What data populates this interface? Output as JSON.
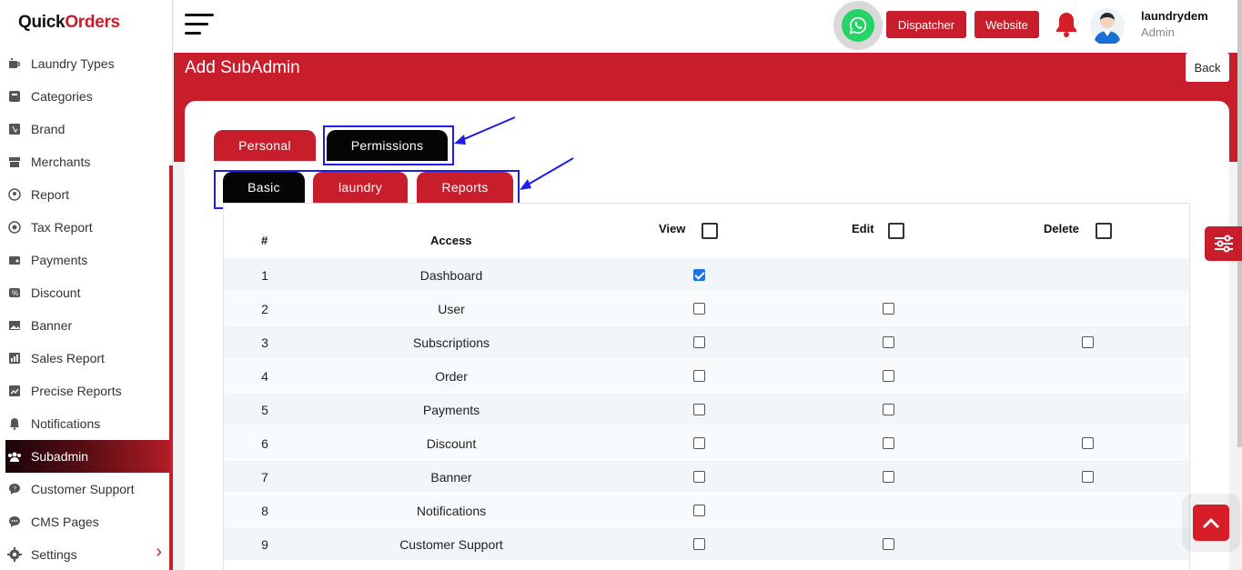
{
  "brand": {
    "part1": "Quick",
    "part2": "Orders"
  },
  "sidebar": {
    "items": [
      {
        "label": "Laundry Types",
        "icon": "cup-icon"
      },
      {
        "label": "Categories",
        "icon": "box-icon"
      },
      {
        "label": "Brand",
        "icon": "bookmark-icon"
      },
      {
        "label": "Merchants",
        "icon": "store-icon"
      },
      {
        "label": "Report",
        "icon": "report-icon"
      },
      {
        "label": "Tax Report",
        "icon": "tax-icon"
      },
      {
        "label": "Payments",
        "icon": "wallet-icon"
      },
      {
        "label": "Discount",
        "icon": "percent-icon"
      },
      {
        "label": "Banner",
        "icon": "image-icon"
      },
      {
        "label": "Sales Report",
        "icon": "chart-icon"
      },
      {
        "label": "Precise Reports",
        "icon": "chart-line-icon"
      },
      {
        "label": "Notifications",
        "icon": "bell-icon"
      },
      {
        "label": "Subadmin",
        "icon": "users-icon",
        "active": true
      },
      {
        "label": "Customer Support",
        "icon": "chat-icon"
      },
      {
        "label": "CMS Pages",
        "icon": "message-icon"
      },
      {
        "label": "Settings",
        "icon": "gear-icon"
      }
    ]
  },
  "header": {
    "dispatcher_label": "Dispatcher",
    "website_label": "Website",
    "user_name": "laundrydem",
    "user_role": "Admin"
  },
  "page": {
    "title": "Add SubAdmin",
    "back_label": "Back"
  },
  "tabs": {
    "personal": "Personal",
    "permissions": "Permissions"
  },
  "subtabs": {
    "basic": "Basic",
    "laundry": "laundry",
    "reports": "Reports"
  },
  "table": {
    "headers": {
      "num": "#",
      "access": "Access",
      "view": "View",
      "edit": "Edit",
      "delete": "Delete"
    },
    "rows": [
      {
        "num": "1",
        "access": "Dashboard",
        "view": true,
        "edit": null,
        "delete": null
      },
      {
        "num": "2",
        "access": "User",
        "view": false,
        "edit": false,
        "delete": null
      },
      {
        "num": "3",
        "access": "Subscriptions",
        "view": false,
        "edit": false,
        "delete": false
      },
      {
        "num": "4",
        "access": "Order",
        "view": false,
        "edit": false,
        "delete": null
      },
      {
        "num": "5",
        "access": "Payments",
        "view": false,
        "edit": false,
        "delete": null
      },
      {
        "num": "6",
        "access": "Discount",
        "view": false,
        "edit": false,
        "delete": false
      },
      {
        "num": "7",
        "access": "Banner",
        "view": false,
        "edit": false,
        "delete": false
      },
      {
        "num": "8",
        "access": "Notifications",
        "view": false,
        "edit": null,
        "delete": null
      },
      {
        "num": "9",
        "access": "Customer Support",
        "view": false,
        "edit": false,
        "delete": null
      }
    ]
  },
  "colors": {
    "brand_red": "#c81e2b",
    "black": "#050505",
    "highlight_blue": "#1e1ee6",
    "whatsapp_green": "#25d366"
  }
}
